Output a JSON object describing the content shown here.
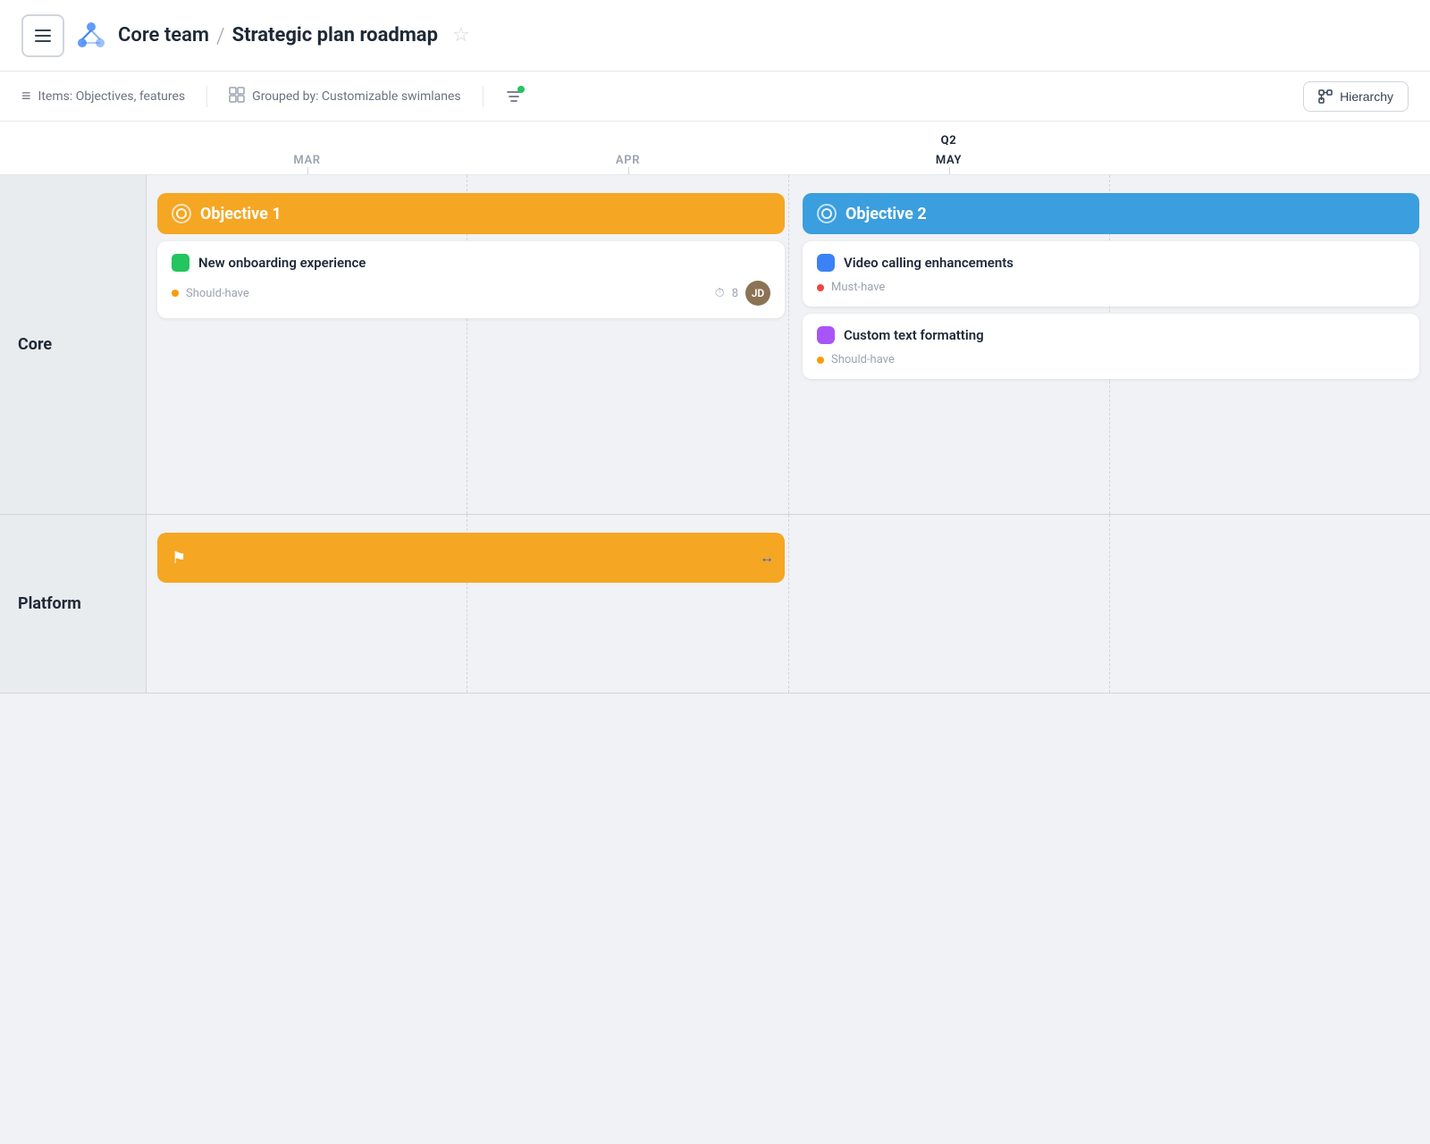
{
  "header": {
    "menu_label": "Menu",
    "logo_alt": "Core team logo",
    "breadcrumb_team": "Core team",
    "breadcrumb_separator": "/",
    "breadcrumb_page": "Strategic plan roadmap",
    "star_label": "Favorite"
  },
  "toolbar": {
    "items_label": "Items: Objectives, features",
    "grouped_label": "Grouped by: Customizable swimlanes",
    "filter_label": "Filter",
    "hierarchy_label": "Hierarchy"
  },
  "timeline": {
    "months": [
      "MAR",
      "APR",
      "MAY"
    ],
    "quarter": "Q2",
    "quarter_month_index": 2
  },
  "swimlanes": [
    {
      "id": "core",
      "label": "Core",
      "objectives": [
        {
          "id": "obj1",
          "title": "Objective 1",
          "color": "yellow",
          "features": [
            {
              "title": "New onboarding experience",
              "color": "#22c55e",
              "priority": "Should-have",
              "priority_color": "orange",
              "estimate": "8",
              "has_avatar": true,
              "avatar_initials": "JD"
            }
          ]
        },
        {
          "id": "obj2",
          "title": "Objective 2",
          "color": "blue",
          "features": [
            {
              "title": "Video calling enhancements",
              "color": "#3b82f6",
              "priority": "Must-have",
              "priority_color": "red",
              "has_avatar": false
            },
            {
              "title": "Custom text formatting",
              "color": "#a855f7",
              "priority": "Should-have",
              "priority_color": "orange",
              "has_avatar": false
            }
          ]
        }
      ]
    },
    {
      "id": "platform",
      "label": "Platform",
      "milestone": {
        "has_flag": true
      }
    }
  ],
  "icons": {
    "hamburger": "☰",
    "star": "☆",
    "items": "≡",
    "grouped": "⊟",
    "filter": "⇌",
    "hierarchy": "⊟",
    "clock": "⏱",
    "flag": "⚑",
    "resize": "↔"
  }
}
